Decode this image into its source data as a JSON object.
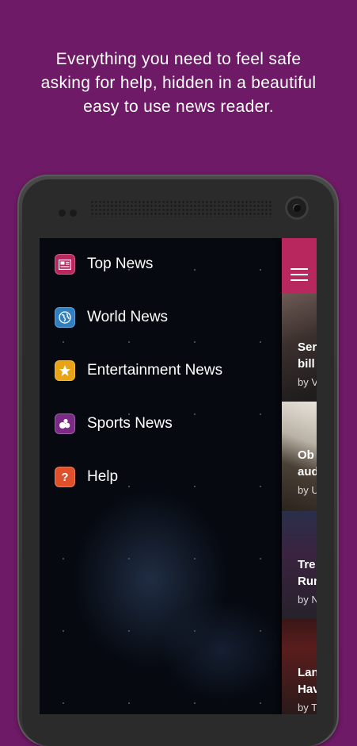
{
  "tagline": {
    "line1": "Everything you need to feel safe",
    "line2": "asking for help, hidden in a beautiful",
    "line3": "easy to use news reader."
  },
  "colors": {
    "background": "#6f1a66",
    "app_bar": "#b8285e"
  },
  "drawer": {
    "items": [
      {
        "label": "Top News",
        "icon": "newspaper-icon",
        "color": "#b8285e"
      },
      {
        "label": "World News",
        "icon": "globe-icon",
        "color": "#2f7fc1"
      },
      {
        "label": "Entertainment News",
        "icon": "star-icon",
        "color": "#e8a317"
      },
      {
        "label": "Sports News",
        "icon": "sports-icon",
        "color": "#7b2a86"
      },
      {
        "label": "Help",
        "icon": "question-icon",
        "color": "#e0502a"
      }
    ]
  },
  "feed": {
    "menu_icon": "hamburger-icon",
    "cards": [
      {
        "title_l1": "Ser",
        "title_l2": "bill",
        "byline": "by V"
      },
      {
        "title_l1": "Ob",
        "title_l2": "aud",
        "byline": "by U"
      },
      {
        "title_l1": "Tre",
        "title_l2": "Run",
        "byline": "by N"
      },
      {
        "title_l1": "Lan",
        "title_l2": "Hav",
        "byline": "by T"
      }
    ]
  }
}
